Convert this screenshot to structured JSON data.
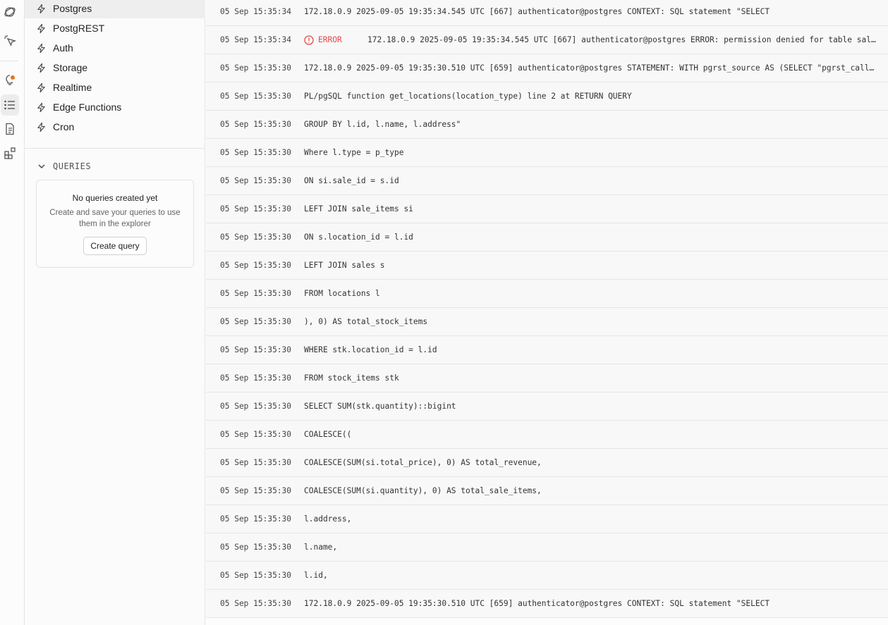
{
  "sidebar": {
    "sources": [
      {
        "label": "Postgres",
        "active": true
      },
      {
        "label": "PostgREST"
      },
      {
        "label": "Auth"
      },
      {
        "label": "Storage"
      },
      {
        "label": "Realtime"
      },
      {
        "label": "Edge Functions"
      },
      {
        "label": "Cron"
      }
    ],
    "queries": {
      "heading": "QUERIES",
      "empty_title": "No queries created yet",
      "empty_desc": "Create and save your queries to use them in the explorer",
      "create_button": "Create query"
    }
  },
  "colors": {
    "error": "#e5484d",
    "notification": "#e8741c"
  },
  "logs": [
    {
      "ts": "05 Sep 15:35:34",
      "msg": "172.18.0.9 2025-09-05 19:35:34.545 UTC [667] authenticator@postgres CONTEXT: SQL statement \"SELECT"
    },
    {
      "ts": "05 Sep 15:35:34",
      "level": "ERROR",
      "msg": "172.18.0.9 2025-09-05 19:35:34.545 UTC [667] authenticator@postgres ERROR: permission denied for table sale_items"
    },
    {
      "ts": "05 Sep 15:35:30",
      "msg": "172.18.0.9 2025-09-05 19:35:30.510 UTC [659] authenticator@postgres STATEMENT: WITH pgrst_source AS (SELECT \"pgrst_call\".* FROM"
    },
    {
      "ts": "05 Sep 15:35:30",
      "msg": "PL/pgSQL function get_locations(location_type) line 2 at RETURN QUERY"
    },
    {
      "ts": "05 Sep 15:35:30",
      "msg": "GROUP BY l.id, l.name, l.address\""
    },
    {
      "ts": "05 Sep 15:35:30",
      "msg": "Where l.type = p_type"
    },
    {
      "ts": "05 Sep 15:35:30",
      "msg": "ON si.sale_id = s.id"
    },
    {
      "ts": "05 Sep 15:35:30",
      "msg": "LEFT JOIN sale_items si"
    },
    {
      "ts": "05 Sep 15:35:30",
      "msg": "ON s.location_id = l.id"
    },
    {
      "ts": "05 Sep 15:35:30",
      "msg": "LEFT JOIN sales s"
    },
    {
      "ts": "05 Sep 15:35:30",
      "msg": "FROM locations l"
    },
    {
      "ts": "05 Sep 15:35:30",
      "msg": "), 0) AS total_stock_items"
    },
    {
      "ts": "05 Sep 15:35:30",
      "msg": "WHERE stk.location_id = l.id"
    },
    {
      "ts": "05 Sep 15:35:30",
      "msg": "FROM stock_items stk"
    },
    {
      "ts": "05 Sep 15:35:30",
      "msg": "SELECT SUM(stk.quantity)::bigint"
    },
    {
      "ts": "05 Sep 15:35:30",
      "msg": "COALESCE(("
    },
    {
      "ts": "05 Sep 15:35:30",
      "msg": "COALESCE(SUM(si.total_price), 0) AS total_revenue,"
    },
    {
      "ts": "05 Sep 15:35:30",
      "msg": "COALESCE(SUM(si.quantity), 0) AS total_sale_items,"
    },
    {
      "ts": "05 Sep 15:35:30",
      "msg": "l.address,"
    },
    {
      "ts": "05 Sep 15:35:30",
      "msg": "l.name,"
    },
    {
      "ts": "05 Sep 15:35:30",
      "msg": "l.id,"
    },
    {
      "ts": "05 Sep 15:35:30",
      "msg": "172.18.0.9 2025-09-05 19:35:30.510 UTC [659] authenticator@postgres CONTEXT: SQL statement \"SELECT"
    }
  ]
}
